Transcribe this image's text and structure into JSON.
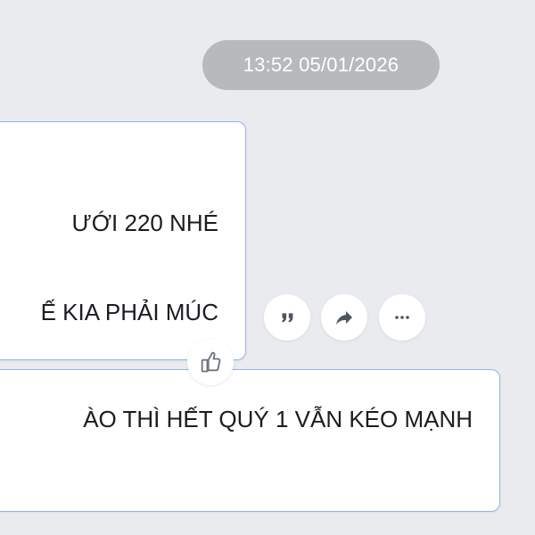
{
  "chat": {
    "timestamp": "13:52 05/01/2026",
    "messages": [
      {
        "lines": [
          "ƯỚI 220 NHÉ",
          "Ế KIA PHẢI MÚC"
        ]
      },
      {
        "lines": [
          "ÀO THÌ HẾT QUÝ 1 VẪN KÉO MẠNH"
        ]
      }
    ]
  },
  "actions": {
    "quote_icon": "quote-icon",
    "share_icon": "share-icon",
    "more_icon": "more-icon",
    "like_icon": "thumbs-up-icon"
  },
  "colors": {
    "background": "#e9ebee",
    "timestamp_pill": "#b7b9bc",
    "bubble_border": "#91b4ea",
    "icon": "#5a6473"
  }
}
